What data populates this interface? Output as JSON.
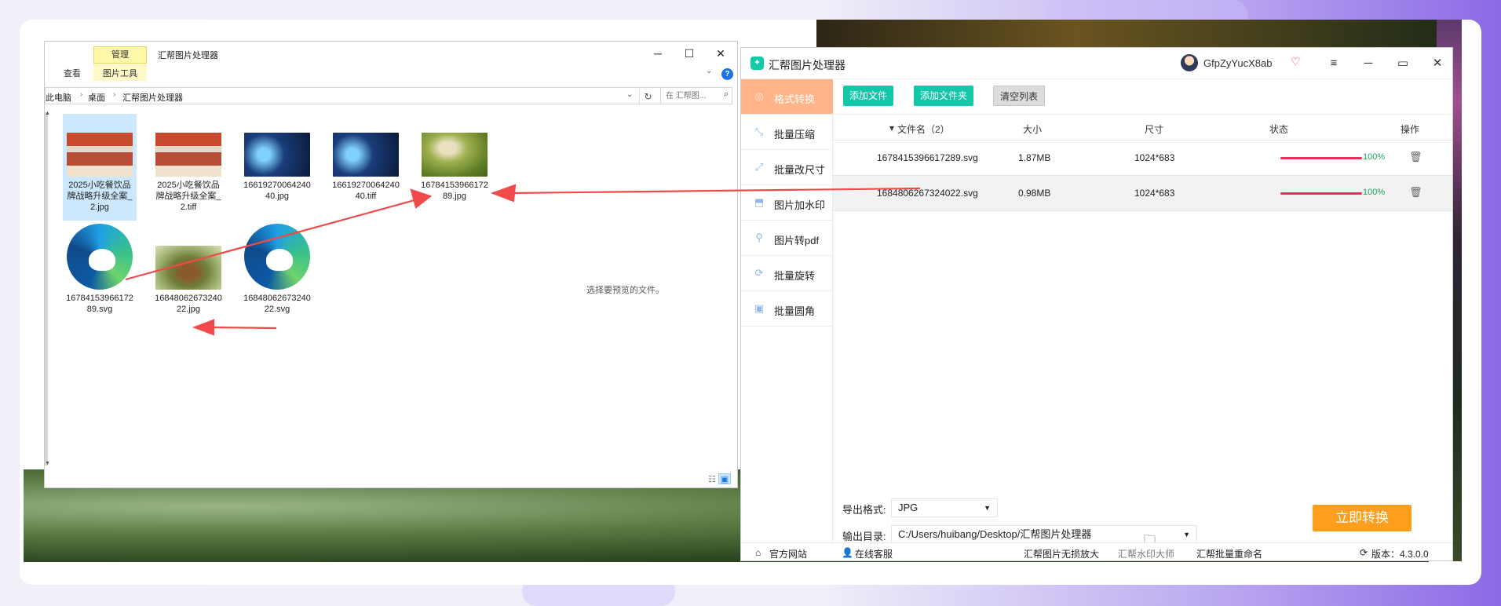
{
  "explorer": {
    "title": "汇帮图片处理器",
    "ribbon": {
      "manage": "管理",
      "view": "查看",
      "tools": "图片工具"
    },
    "address": {
      "crumbs": [
        "此电脑",
        "桌面",
        "汇帮图片处理器"
      ]
    },
    "search_placeholder": "在 汇帮图...",
    "files": [
      {
        "name": "2025小吃餐饮品牌战略升级全案_2.jpg",
        "kind": "photo",
        "selected": true
      },
      {
        "name": "2025小吃餐饮品牌战略升级全案_2.tiff",
        "kind": "photo"
      },
      {
        "name": "1661927006424040.jpg",
        "kind": "photo"
      },
      {
        "name": "1661927006424040.tiff",
        "kind": "photo"
      },
      {
        "name": "1678415396617289.jpg",
        "kind": "photo"
      },
      {
        "name": "1678415396617289.svg",
        "kind": "edge"
      },
      {
        "name": "1684806267324022.jpg",
        "kind": "photo"
      },
      {
        "name": "1684806267324022.svg",
        "kind": "edge"
      }
    ],
    "preview_text": "选择要预览的文件。"
  },
  "app": {
    "name": "汇帮图片处理器",
    "username": "GfpZyYucX8ab",
    "sidebar": [
      {
        "label": "格式转换",
        "icon": "◎",
        "active": true
      },
      {
        "label": "批量压缩",
        "icon": "⤡"
      },
      {
        "label": "批量改尺寸",
        "icon": "⤢"
      },
      {
        "label": "图片加水印",
        "icon": "⬒"
      },
      {
        "label": "图片转pdf",
        "icon": "⚲"
      },
      {
        "label": "批量旋转",
        "icon": "⟳"
      },
      {
        "label": "批量圆角",
        "icon": "▣"
      }
    ],
    "toolbar": {
      "add_file": "添加文件",
      "add_folder": "添加文件夹",
      "clear_list": "清空列表"
    },
    "table": {
      "headers": {
        "filename": "文件名（2）",
        "size": "大小",
        "dimension": "尺寸",
        "status": "状态",
        "action": "操作"
      },
      "rows": [
        {
          "filename": "1678415396617289.svg",
          "size": "1.87MB",
          "dimension": "1024*683",
          "progress": 100,
          "percent": "100%"
        },
        {
          "filename": "1684806267324022.svg",
          "size": "0.98MB",
          "dimension": "1024*683",
          "progress": 100,
          "percent": "100%"
        }
      ]
    },
    "settings": {
      "format_label": "导出格式:",
      "format_value": "JPG",
      "dir_label": "输出目录:",
      "dir_value": "C:/Users/huibang/Desktop/汇帮图片处理器"
    },
    "convert_button": "立即转换",
    "footer": {
      "website": "官方网站",
      "service": "在线客服",
      "link1": "汇帮图片无损放大",
      "link2": "汇帮水印大师",
      "link3": "汇帮批量重命名",
      "version": "版本：4.3.0.0"
    }
  },
  "colors": {
    "accent_teal": "#15c6a9",
    "accent_orange": "#ff9d1c",
    "sidebar_active": "#ffb48a",
    "progress": "#e8305a",
    "arrow": "#f04a4a"
  }
}
